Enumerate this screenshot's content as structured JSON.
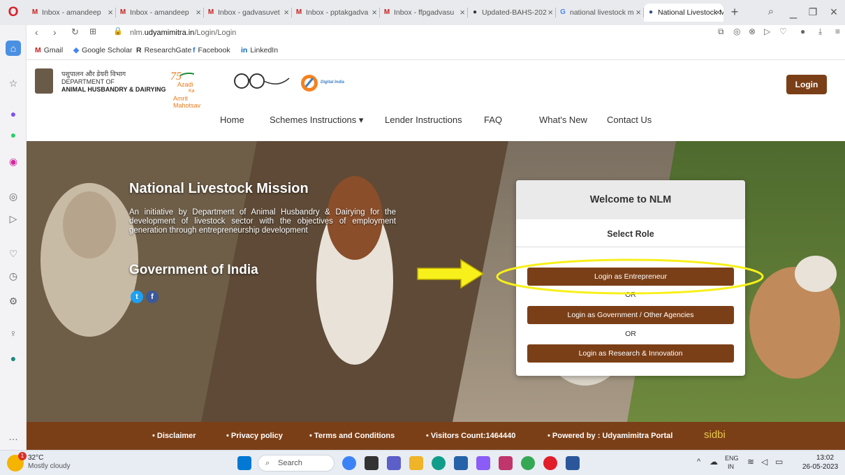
{
  "browser": {
    "tabs": [
      {
        "label": "Inbox - amandeep",
        "fav": "M"
      },
      {
        "label": "Inbox - amandeep",
        "fav": "M"
      },
      {
        "label": "Inbox - gadvasuvet",
        "fav": "M"
      },
      {
        "label": "Inbox - pptakgadva",
        "fav": "M"
      },
      {
        "label": "Inbox - ffpgadvasu",
        "fav": "M"
      },
      {
        "label": "Updated-BAHS-202",
        "fav": "●"
      },
      {
        "label": "national livestock m",
        "fav": "G"
      },
      {
        "label": "National Livestock M",
        "fav": "●"
      }
    ],
    "url_prefix": "nlm.",
    "url_domain": "udyamimitra.in",
    "url_path": "/Login/Login",
    "bookmarks": [
      "Gmail",
      "Google Scholar",
      "ResearchGate",
      "Facebook",
      "LinkedIn"
    ]
  },
  "site": {
    "dept_hindi": "पशुपालन और डेयरी विभाग",
    "dept_line1": "DEPARTMENT OF",
    "dept_line2": "ANIMAL HUSBANDRY & DAIRYING",
    "azadi_1": "Azadi",
    "azadi_2": "Ka",
    "azadi_3": "Amrit Mahotsav",
    "digital_india": "Digital India",
    "login_label": "Login",
    "nav": [
      "Home",
      "Schemes Instructions ▾",
      "Lender Instructions",
      "FAQ",
      "What's New",
      "Contact Us"
    ]
  },
  "hero": {
    "title": "National Livestock Mission",
    "description": "An initiative by Department of Animal Husbandry & Dairying for the development of livestock sector with the objectives of employment generation through entrepreneurship development",
    "gov": "Government of India"
  },
  "card": {
    "title": "Welcome to NLM",
    "role": "Select Role",
    "btn1": "Login as Entrepreneur",
    "or1": "OR",
    "btn2": "Login as Government / Other Agencies",
    "or2": "OR",
    "btn3": "Login as Research & Innovation"
  },
  "footer": {
    "items": [
      "Disclaimer",
      "Privacy policy",
      "Terms and Conditions",
      "Visitors Count:1464440",
      "Powered by : Udyamimitra Portal"
    ],
    "sidbi": "sidbi"
  },
  "taskbar": {
    "temp": "32°C",
    "weather": "Mostly cloudy",
    "search": "Search",
    "lang1": "ENG",
    "lang2": "IN",
    "time": "13:02",
    "date": "26-05-2023"
  },
  "colors": {
    "brand": "#7b3f17",
    "highlight": "#f7f01a"
  }
}
